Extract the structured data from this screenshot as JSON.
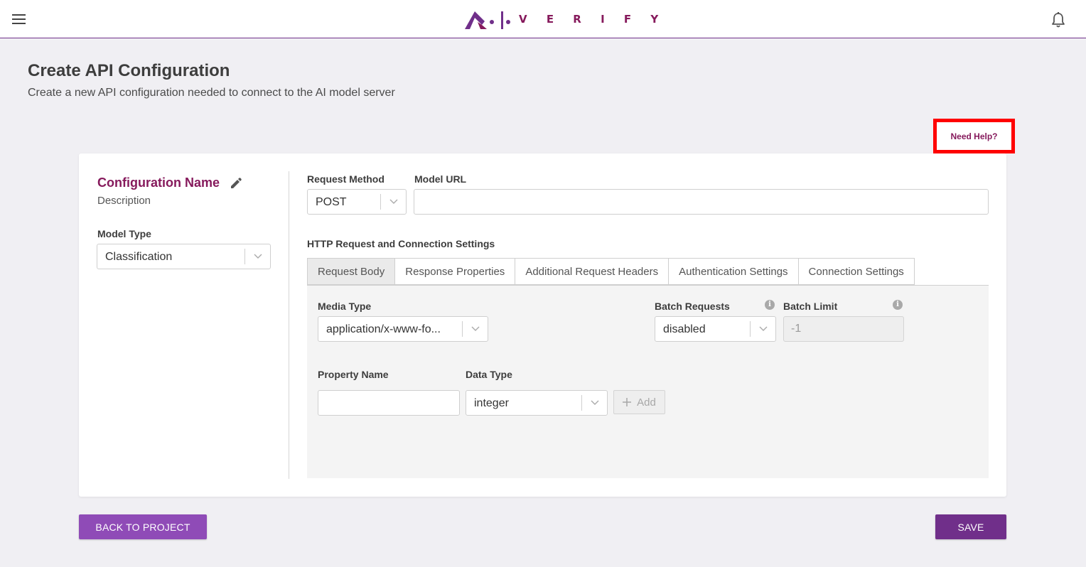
{
  "app": {
    "logo_text": "V E R I F Y",
    "accent_color": "#702f8a",
    "brand_text_color": "#861a5c"
  },
  "page": {
    "title": "Create API Configuration",
    "subtitle": "Create a new API configuration needed to connect to the AI model server",
    "help_label": "Need Help?"
  },
  "config": {
    "name": "Configuration Name",
    "description": "Description",
    "model_type_label": "Model Type",
    "model_type_value": "Classification"
  },
  "request": {
    "method_label": "Request Method",
    "method_value": "POST",
    "url_label": "Model URL",
    "url_value": "",
    "section_title": "HTTP Request and Connection Settings"
  },
  "tabs": [
    {
      "label": "Request Body"
    },
    {
      "label": "Response Properties"
    },
    {
      "label": "Additional Request Headers"
    },
    {
      "label": "Authentication Settings"
    },
    {
      "label": "Connection Settings"
    }
  ],
  "request_body": {
    "media_type_label": "Media Type",
    "media_type_value": "application/x-www-fo...",
    "batch_requests_label": "Batch Requests",
    "batch_requests_value": "disabled",
    "batch_limit_label": "Batch Limit",
    "batch_limit_value": "-1",
    "property_name_label": "Property Name",
    "property_name_value": "",
    "data_type_label": "Data Type",
    "data_type_value": "integer",
    "add_label": "Add"
  },
  "footer": {
    "back_label": "BACK TO PROJECT",
    "save_label": "SAVE",
    "back_color": "#8f4bb7",
    "save_color": "#702f8a"
  }
}
